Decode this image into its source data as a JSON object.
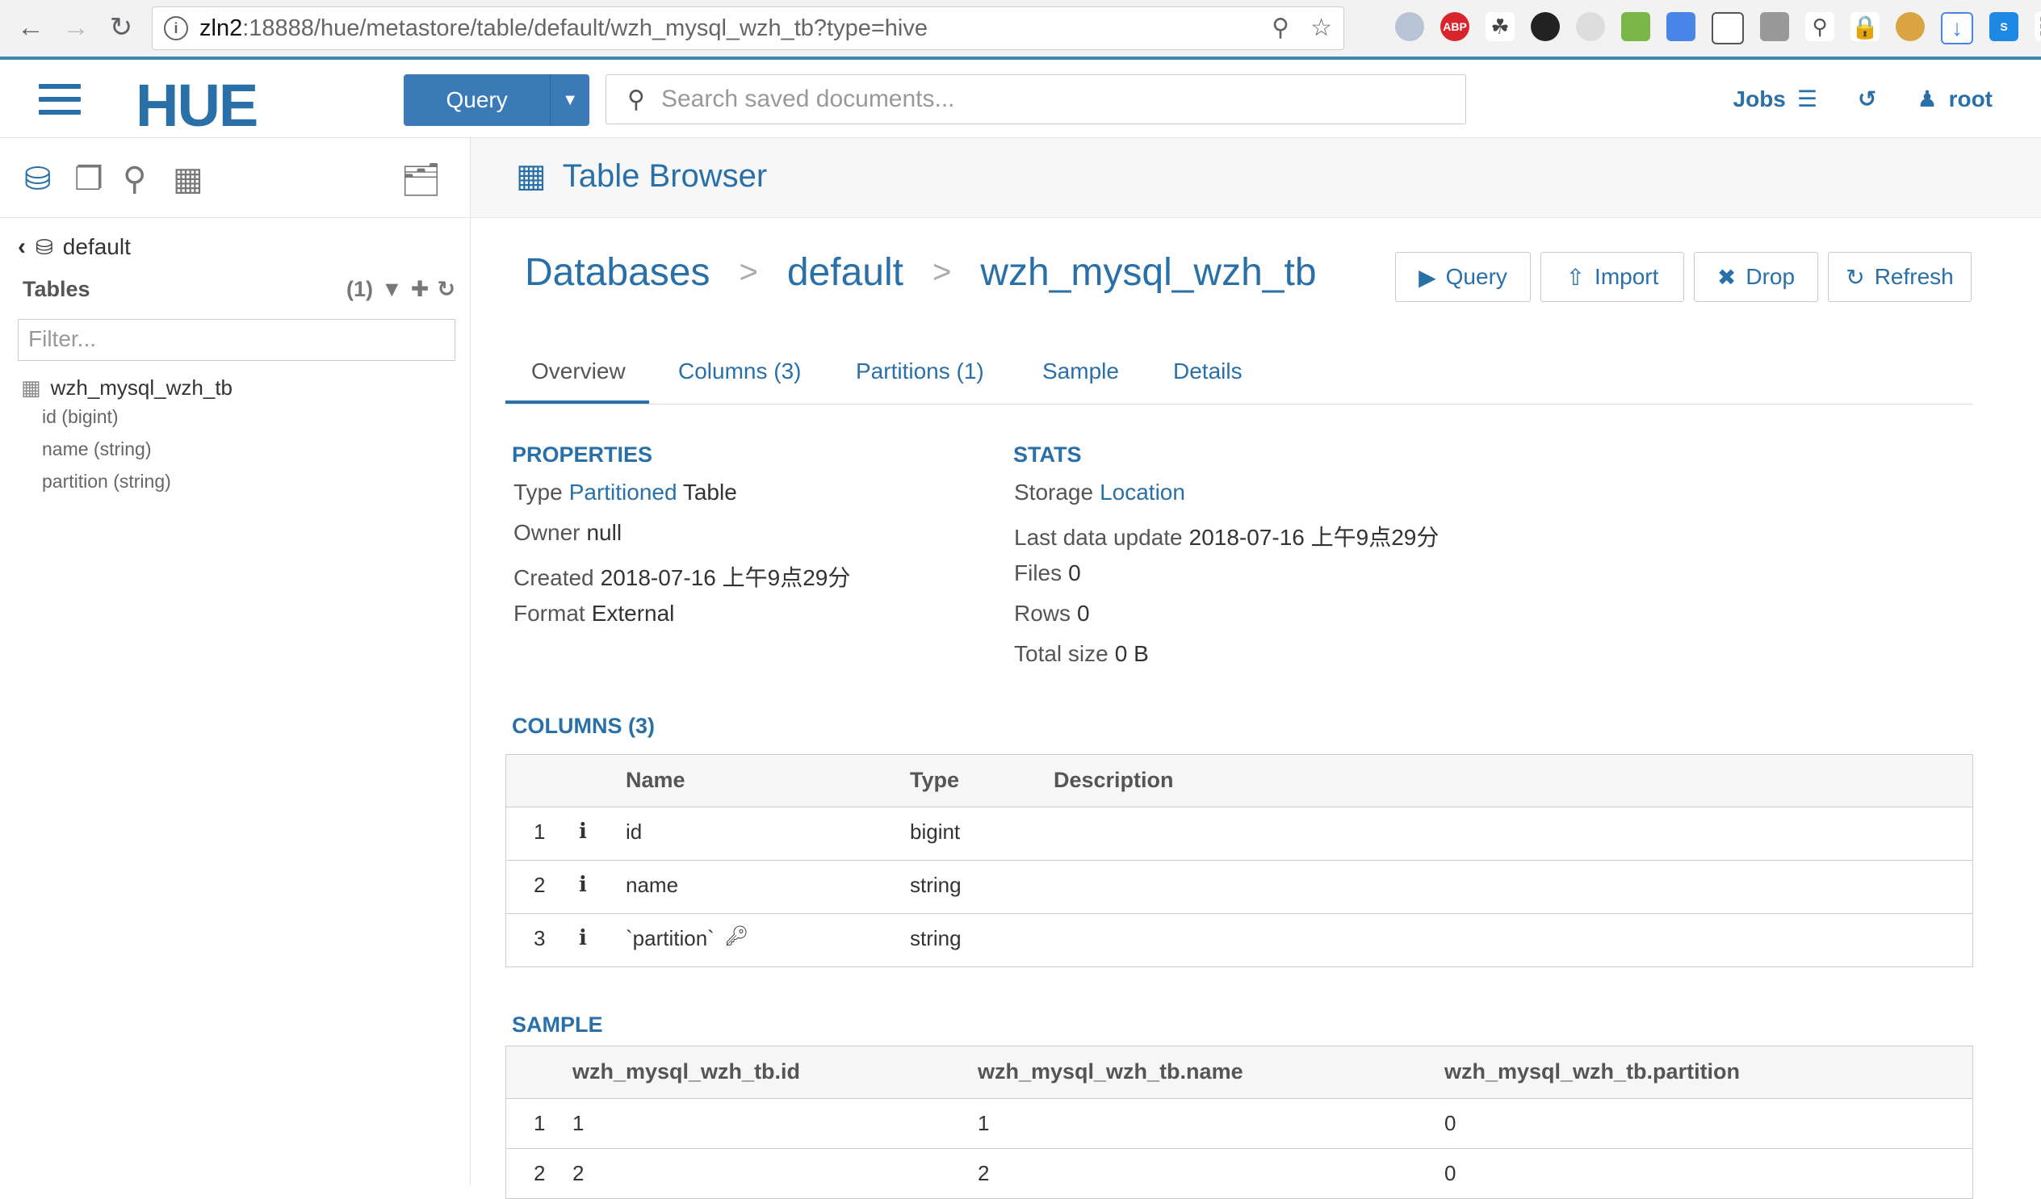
{
  "browser": {
    "url_host": "zln2",
    "url_rest": ":18888/hue/metastore/table/default/wzh_mysql_wzh_tb?type=hive",
    "ext_abp": "ABP"
  },
  "topnav": {
    "logo": "HUE",
    "query_label": "Query",
    "search_placeholder": "Search saved documents...",
    "jobs_label": "Jobs",
    "user_label": "root"
  },
  "leftpanel": {
    "database": "default",
    "tables_label": "Tables",
    "tables_count": "(1)",
    "filter_placeholder": "Filter...",
    "table_name": "wzh_mysql_wzh_tb",
    "columns": [
      "id (bigint)",
      "name (string)",
      "partition (string)"
    ]
  },
  "main": {
    "title": "Table Browser",
    "breadcrumb": [
      "Databases",
      "default",
      "wzh_mysql_wzh_tb"
    ],
    "actions": [
      "Query",
      "Import",
      "Drop",
      "Refresh"
    ],
    "tabs": [
      "Overview",
      "Columns (3)",
      "Partitions (1)",
      "Sample",
      "Details"
    ]
  },
  "properties": {
    "title": "PROPERTIES",
    "type_label": "Type",
    "type_link": "Partitioned",
    "type_value": "Table",
    "owner_label": "Owner",
    "owner_value": "null",
    "created_label": "Created",
    "created_value": "2018-07-16 上午9点29分",
    "format_label": "Format",
    "format_value": "External"
  },
  "stats": {
    "title": "STATS",
    "storage_label": "Storage",
    "storage_link": "Location",
    "last_update_label": "Last data update",
    "last_update_value": "2018-07-16 上午9点29分",
    "files_label": "Files",
    "files_value": "0",
    "rows_label": "Rows",
    "rows_value": "0",
    "size_label": "Total size",
    "size_value": "0 B"
  },
  "columns_section": {
    "title": "COLUMNS (3)",
    "headers": [
      "Name",
      "Type",
      "Description"
    ],
    "rows": [
      {
        "num": "1",
        "name": "id",
        "type": "bigint"
      },
      {
        "num": "2",
        "name": "name",
        "type": "string"
      },
      {
        "num": "3",
        "name": "`partition`",
        "type": "string"
      }
    ]
  },
  "sample_section": {
    "title": "SAMPLE",
    "headers": [
      "wzh_mysql_wzh_tb.id",
      "wzh_mysql_wzh_tb.name",
      "wzh_mysql_wzh_tb.partition"
    ],
    "rows": [
      {
        "num": "1",
        "c1": "1",
        "c2": "1",
        "c3": "0"
      },
      {
        "num": "2",
        "c1": "2",
        "c2": "2",
        "c3": "0"
      }
    ]
  }
}
